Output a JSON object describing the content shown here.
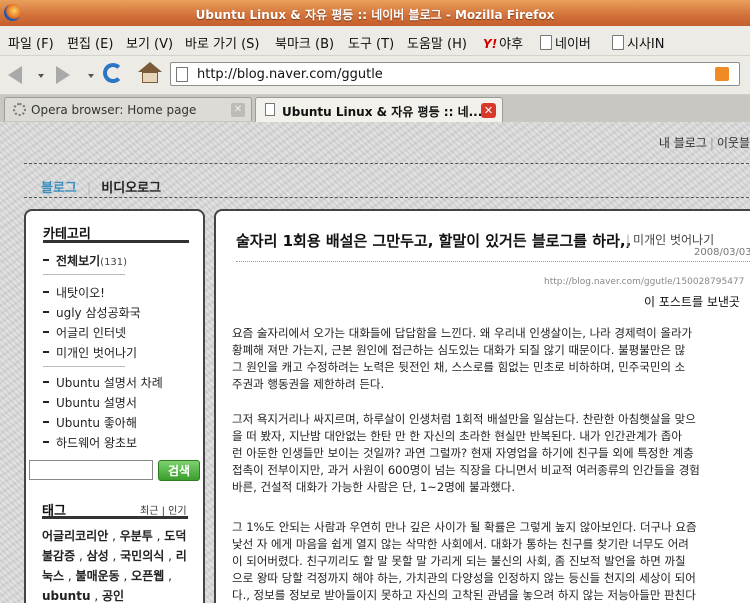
{
  "window": {
    "title": "Ubuntu Linux & 자유 평등 :: 네이버 블로그 - Mozilla Firefox"
  },
  "menu": {
    "items": [
      "파일 (F)",
      "편집 (E)",
      "보기 (V)",
      "바로 가기 (S)",
      "북마크 (B)",
      "도구 (T)",
      "도움말 (H)"
    ],
    "bookmarks": [
      {
        "logo": "Y!",
        "label": "야후"
      },
      {
        "label": "네이버"
      },
      {
        "label": "시사IN"
      }
    ]
  },
  "nav": {
    "url": "http://blog.naver.com/ggutle"
  },
  "tabs": [
    {
      "label": "Opera browser: Home page",
      "active": false
    },
    {
      "label": "Ubuntu Linux & 자유 평등 :: 네...",
      "active": true
    }
  ],
  "blog": {
    "header_links": [
      "내 블로그",
      "이웃블"
    ],
    "top_tabs": {
      "blog": "블로그",
      "video": "비디오로그"
    },
    "sidebar": {
      "category_title": "카테고리",
      "all_view": {
        "label": "전체보기",
        "count": "(131)"
      },
      "group1": [
        "내탓이오!",
        "ugly 삼성공화국",
        "어글리 인터넷",
        "미개인 벗어나기"
      ],
      "group2": [
        "Ubuntu 설명서 차례",
        "Ubuntu 설명서",
        "Ubuntu 좋아해",
        "하드웨어 왕초보"
      ],
      "search_button": "검색",
      "tag_title": "태그",
      "tag_sort": {
        "recent": "최근",
        "popular": "인기"
      },
      "tags": [
        "어글리코리안",
        "우분투",
        "도덕불감증",
        "삼성",
        "국민의식",
        "리눅스",
        "불매운동",
        "오픈웹",
        "ubuntu",
        "공인"
      ]
    },
    "post": {
      "title": "술자리 1회용 배설은 그만두고, 할말이 있거든 블로그를 하라,,",
      "category": "미개인 벗어나기",
      "date": "2008/03/03",
      "url": "http://blog.naver.com/ggutle/150028795477",
      "who_see": "이 포스트를 보낸곳",
      "paragraphs": [
        [
          "요즘 술자리에서 오가는 대화들에 답답함을 느낀다. 왜 우리내 인생살이는, 나라 경제력이 올라가",
          "황폐해 져만 가는지, 근본 원인에 접근하는 심도있는 대화가 되질 않기 때문이다. 불평불만은 많",
          "그 원인을 캐고 수정하려는 노력은 뒷전인 채, 스스로를 힘없는 민초로 비하하며, 민주국민의 소",
          "주권과 행동권을 제한하려 든다."
        ],
        [
          "그저 욕지거리나 싸지르며, 하루살이 인생처럼 1회적 배설만을 일삼는다. 찬란한 아침햇살을 맞으",
          "을 떠 봤자, 지난밤 대안없는 한탄 만 한 자신의 초라한 현실만 반복된다. 내가 인간관계가 좁아",
          "런 아둔한 인생들만 보이는 것일까? 과연 그럴까? 현재 자영업을 하기에 친구들 외에 특정한 계층",
          "접촉이 전부이지만, 과거 사원이 600명이 넘는 직장을 다니면서 비교적 여러종류의 인간들을 경험",
          "바른, 건설적 대화가 가능한 사람은 단, 1~2명에 불과했다."
        ],
        [
          "그 1%도 안되는 사람과 우연히 만나 깊은 사이가 될 확률은 그렇게 높지 않아보인다. 더구나 요즘",
          "낯선 자 에게 마음을 쉽게 열지 않는 삭막한 사회에서. 대화가 통하는 친구를 찾기란 너무도 어려",
          "이 되어버렸다. 친구끼리도 할 말 못할 말 가리게 되는 불신의 사회, 좀 진보적 발언을 하면 까칠",
          "으로 왕따 당할 걱정까지 해야 하는, 가치관의 다양성을 인정하지 않는 등신들 천지의 세상이 되어",
          "다., 정보를 정보로 받아들이지 못하고 자신의 고착된 관념을 놓으려 하지 않는 저능아들만 판친다"
        ]
      ]
    }
  }
}
